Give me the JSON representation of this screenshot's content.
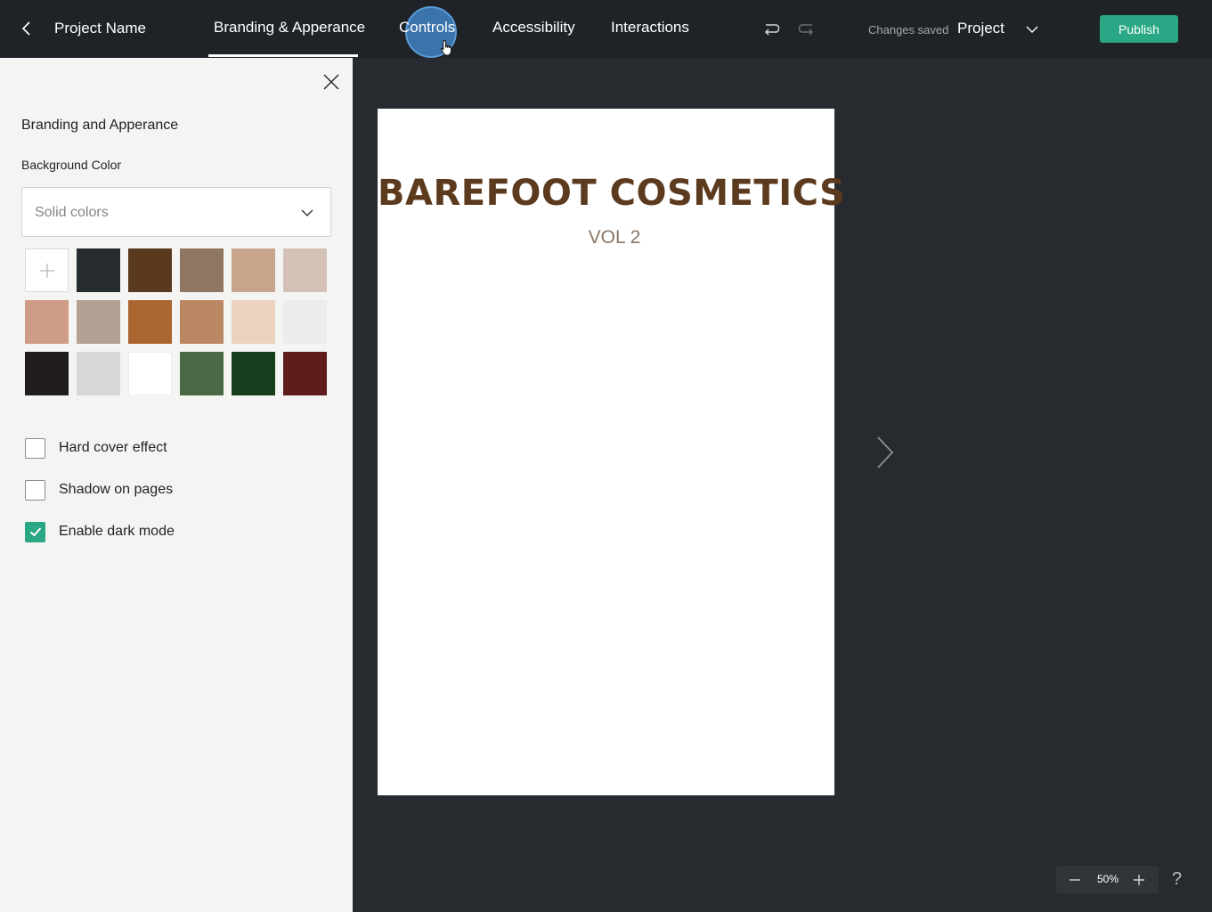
{
  "topbar": {
    "project_name": "Project Name",
    "tabs": [
      {
        "label": "Branding & Apperance",
        "active": true
      },
      {
        "label": "Controls",
        "active": false
      },
      {
        "label": "Accessibility",
        "active": false
      },
      {
        "label": "Interactions",
        "active": false
      }
    ],
    "status": "Changes saved",
    "project_dropdown": "Project",
    "publish_label": "Publish",
    "icons": [
      "chevron-left-icon",
      "undo-icon",
      "redo-icon",
      "chevron-down-icon"
    ]
  },
  "panel": {
    "title": "Branding and Apperance",
    "background_label": "Background Color",
    "select_value": "Solid colors",
    "swatches": [
      "#262b2f",
      "#5a3a1f",
      "#8f7762",
      "#c7a48b",
      "#d4c1b6",
      "#cf9c86",
      "#b3a193",
      "#ab6531",
      "#bb8763",
      "#edd3bf",
      "#edecea",
      "#211d1c",
      "#d7d7d5",
      "#ffffff",
      "#496844",
      "#183f1d",
      "#5e1c1d"
    ],
    "options": [
      {
        "label": "Hard cover effect",
        "checked": false
      },
      {
        "label": "Shadow on pages",
        "checked": false
      },
      {
        "label": "Enable dark mode",
        "checked": true
      }
    ]
  },
  "canvas": {
    "title": "BAREFOOT COSMETICS",
    "subtitle": "VOL 2",
    "zoom": "50%",
    "help": "?"
  },
  "colors": {
    "accent": "#2aa784",
    "topbar": "#1f2327",
    "canvas_bg": "#272b2f",
    "panel_bg": "#f4f4f3",
    "title_brown": "#5c3a1e"
  }
}
